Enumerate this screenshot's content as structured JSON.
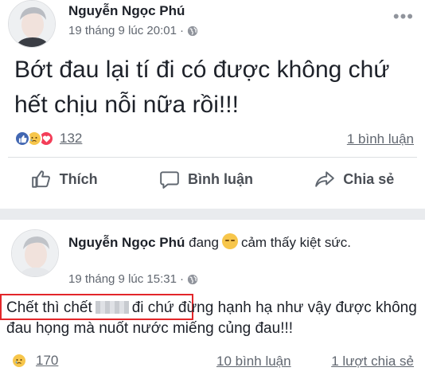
{
  "post1": {
    "author": "Nguyễn Ngọc Phú",
    "timestamp": "19 tháng 9 lúc 20:01",
    "separator": "·",
    "more_icon": "ellipsis-icon",
    "content": "Bớt đau lại tí đi có được không chứ hết chịu nỗi nữa rồi!!!",
    "reaction_count": "132",
    "comments_link": "1 bình luận",
    "actions": {
      "like": "Thích",
      "comment": "Bình luận",
      "share": "Chia sẻ"
    }
  },
  "post2": {
    "author": "Nguyễn Ngọc Phú",
    "feeling_prefix": "đang",
    "feeling_text": "cảm thấy kiệt sức.",
    "timestamp": "19 tháng 9 lúc 15:31",
    "separator": "·",
    "content_highlighted_a": "Chết thì chết",
    "content_highlighted_b": "đi chứ",
    "content_rest": "đừng hạnh hạ như vậy được không đau họng mà nuốt nước miếng củng đau!!!",
    "reaction_count": "170",
    "comments_link": "10 bình luận",
    "shares_link": "1 lượt chia sẻ"
  },
  "colors": {
    "like_blue": "#4267b2",
    "love_red": "#f33e58",
    "sad_yellow": "#f7c64b",
    "highlight_red": "#e3262a"
  }
}
